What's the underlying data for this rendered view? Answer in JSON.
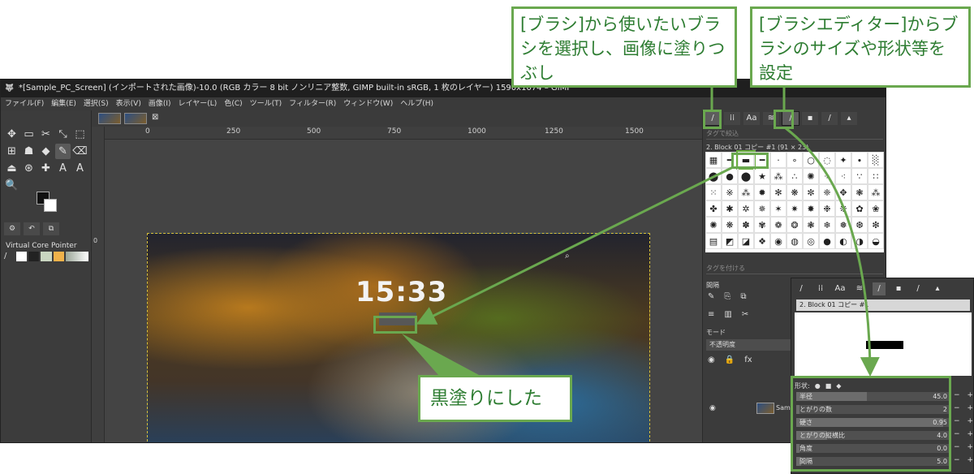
{
  "window": {
    "title": "*[Sample_PC_Screen] (インポートされた画像)-10.0 (RGB カラー 8 bit ノンリニア整数, GIMP built-in sRGB, 1 枚のレイヤー) 1590x1074 – GIMP"
  },
  "menu": [
    "ファイル(F)",
    "編集(E)",
    "選択(S)",
    "表示(V)",
    "画像(I)",
    "レイヤー(L)",
    "色(C)",
    "ツール(T)",
    "フィルター(R)",
    "ウィンドウ(W)",
    "ヘルプ(H)"
  ],
  "ruler": [
    "0",
    "250",
    "500",
    "750",
    "1000",
    "1250",
    "1500"
  ],
  "toolbox": {
    "tools": [
      "✥",
      "▭",
      "✂",
      "⤡",
      "⬚",
      "⊞",
      "☗",
      "◆",
      "✎",
      "⌫",
      "⏏",
      "⊛",
      "✚",
      "A",
      "A",
      "🔍"
    ],
    "device_label": "Virtual Core Pointer"
  },
  "canvas": {
    "clock": "15:33"
  },
  "dock": {
    "tag_filter": "タグで絞込",
    "brush_name": "2. Block 01 コピー #1 (91 × 23)",
    "tag_assign": "タグを付ける",
    "spacing_label": "間隔",
    "mode_label": "モード",
    "opacity_label": "不透明度",
    "layer_name": "Sam"
  },
  "editor": {
    "brush_name": "2. Block 01 コピー #1",
    "shape_label": "形状:",
    "params": [
      {
        "label": "半径",
        "value": "45.0",
        "fill": 0.46
      },
      {
        "label": "とがりの数",
        "value": "2",
        "fill": 0.02
      },
      {
        "label": "硬さ",
        "value": "0.95",
        "fill": 0.95
      },
      {
        "label": "とがりの縦横比",
        "value": "4.0",
        "fill": 0.2
      },
      {
        "label": "角度",
        "value": "0.0",
        "fill": 0.0
      },
      {
        "label": "間隔",
        "value": "5.0",
        "fill": 0.03
      }
    ]
  },
  "callouts": {
    "brush_select": "[ブラシ]から使いたいブラシを選択し、画像に塗りつぶし",
    "brush_editor": "[ブラシエディター]からブラシのサイズや形状等を設定",
    "blacked_out": "黒塗りにした"
  },
  "colors": {
    "callout_green": "#6aa84f",
    "callout_text": "#2e7d32"
  }
}
